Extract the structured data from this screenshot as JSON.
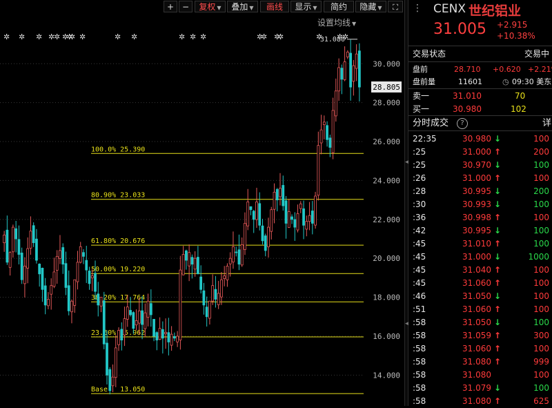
{
  "toolbar": {
    "plus": "+",
    "minus": "−",
    "adjust": "复权",
    "overlay": "叠加",
    "draw": "画线",
    "display": "显示",
    "simple": "简约",
    "hide": "隐藏",
    "set_ma": "设置均线"
  },
  "quote": {
    "ticker": "CENX",
    "name": "世纪铝业",
    "price": "31.005",
    "change": "+2.915",
    "change_pct": "+10.38%",
    "status_label": "交易状态",
    "status_value": "交易中",
    "pre_label": "盘前",
    "pre_price": "28.710",
    "pre_change": "+0.620",
    "pre_pct": "+2.21%",
    "pre_vol_label": "盘前量",
    "pre_vol": "11601",
    "pre_time": "09:30 美东",
    "ask_label": "卖一",
    "ask_price": "31.010",
    "ask_vol": "70",
    "bid_label": "买一",
    "bid_price": "30.980",
    "bid_vol": "102",
    "ticks_label": "分时成交",
    "ticks_detail": "详"
  },
  "ticks": [
    {
      "time": "22:35",
      "price": "30.980",
      "dir": "down",
      "vol": "100",
      "vdir": "up"
    },
    {
      "time": ":25",
      "price": "31.000",
      "dir": "up",
      "vol": "200",
      "vdir": "up"
    },
    {
      "time": ":25",
      "price": "30.970",
      "dir": "down",
      "vol": "100",
      "vdir": "down"
    },
    {
      "time": ":26",
      "price": "31.000",
      "dir": "up",
      "vol": "100",
      "vdir": "up"
    },
    {
      "time": ":28",
      "price": "30.995",
      "dir": "down",
      "vol": "200",
      "vdir": "down"
    },
    {
      "time": ":30",
      "price": "30.993",
      "dir": "down",
      "vol": "100",
      "vdir": "down"
    },
    {
      "time": ":36",
      "price": "30.998",
      "dir": "up",
      "vol": "100",
      "vdir": "up"
    },
    {
      "time": ":42",
      "price": "30.995",
      "dir": "down",
      "vol": "100",
      "vdir": "down"
    },
    {
      "time": ":45",
      "price": "31.010",
      "dir": "up",
      "vol": "100",
      "vdir": "down"
    },
    {
      "time": ":45",
      "price": "31.000",
      "dir": "down",
      "vol": "1000",
      "vdir": "down"
    },
    {
      "time": ":45",
      "price": "31.040",
      "dir": "up",
      "vol": "100",
      "vdir": "up"
    },
    {
      "time": ":45",
      "price": "31.060",
      "dir": "up",
      "vol": "100",
      "vdir": "up"
    },
    {
      "time": ":46",
      "price": "31.050",
      "dir": "down",
      "vol": "100",
      "vdir": "up"
    },
    {
      "time": ":51",
      "price": "31.060",
      "dir": "up",
      "vol": "100",
      "vdir": "up"
    },
    {
      "time": ":58",
      "price": "31.050",
      "dir": "down",
      "vol": "100",
      "vdir": "down"
    },
    {
      "time": ":58",
      "price": "31.059",
      "dir": "up",
      "vol": "300",
      "vdir": "up"
    },
    {
      "time": ":58",
      "price": "31.060",
      "dir": "up",
      "vol": "100",
      "vdir": "up"
    },
    {
      "time": ":58",
      "price": "31.080",
      "dir": "up",
      "vol": "999",
      "vdir": "up"
    },
    {
      "time": ":58",
      "price": "31.080",
      "dir": "none",
      "vol": "100",
      "vdir": "up"
    },
    {
      "time": ":58",
      "price": "31.079",
      "dir": "down",
      "vol": "100",
      "vdir": "down"
    },
    {
      "time": ":58",
      "price": "31.080",
      "dir": "up",
      "vol": "625",
      "vdir": "up"
    }
  ],
  "chart_data": {
    "type": "candlestick",
    "y_ticks": [
      14,
      16,
      18,
      20,
      22,
      24,
      26,
      28,
      30
    ],
    "y_tick_labels": [
      "14.000",
      "16.000",
      "18.000",
      "20.000",
      "22.000",
      "24.000",
      "26.000",
      "28.000",
      "30.000"
    ],
    "ylim": [
      12.7,
      31.5
    ],
    "current_price_label": "28.805",
    "current_price": 28.805,
    "high_label": "31.080",
    "high": 31.08,
    "fib_levels": [
      {
        "label": "100.0% 25.390",
        "value": 25.39
      },
      {
        "label": "80.90% 23.033",
        "value": 23.033
      },
      {
        "label": "61.80% 20.676",
        "value": 20.676
      },
      {
        "label": "50.00% 19.220",
        "value": 19.22
      },
      {
        "label": "38.20% 17.764",
        "value": 17.764
      },
      {
        "label": "23.60% 15.962",
        "value": 15.962
      },
      {
        "label": "Base   13.050",
        "value": 13.05
      }
    ],
    "close_series": [
      21.2,
      19.8,
      20.3,
      21.6,
      21.0,
      20.2,
      18.9,
      19.6,
      20.5,
      21.4,
      20.8,
      19.9,
      19.2,
      18.4,
      17.6,
      17.9,
      18.6,
      19.3,
      20.1,
      20.4,
      19.7,
      18.5,
      17.3,
      17.8,
      18.9,
      19.8,
      20.6,
      20.1,
      19.4,
      18.7,
      19.1,
      18.3,
      17.6,
      18.0,
      15.6,
      14.0,
      13.2,
      13.9,
      15.4,
      16.3,
      15.8,
      16.9,
      17.5,
      17.1,
      16.4,
      16.8,
      17.3,
      16.6,
      17.2,
      17.8,
      17.1,
      16.0,
      15.8,
      16.4,
      15.9,
      16.2,
      15.7,
      16.1,
      15.9,
      16.0,
      19.4,
      20.2,
      19.9,
      20.3,
      19.7,
      20.0,
      19.2,
      18.4,
      17.6,
      17.0,
      17.8,
      18.6,
      17.9,
      18.2,
      18.9,
      19.1,
      19.6,
      20.0,
      20.6,
      20.3,
      19.7,
      20.7,
      21.8,
      22.9,
      22.5,
      22.0,
      22.9,
      21.7,
      20.9,
      20.4,
      21.6,
      22.5,
      23.4,
      23.0,
      23.6,
      22.7,
      21.8,
      22.4,
      22.0,
      21.6,
      22.3,
      22.8,
      21.7,
      21.9,
      22.2,
      21.8,
      23.2,
      25.8,
      26.6,
      27.0,
      26.1,
      25.7,
      27.6,
      28.6,
      29.8,
      29.2,
      30.1,
      30.6,
      28.8,
      29.9,
      30.5,
      28.8
    ]
  }
}
